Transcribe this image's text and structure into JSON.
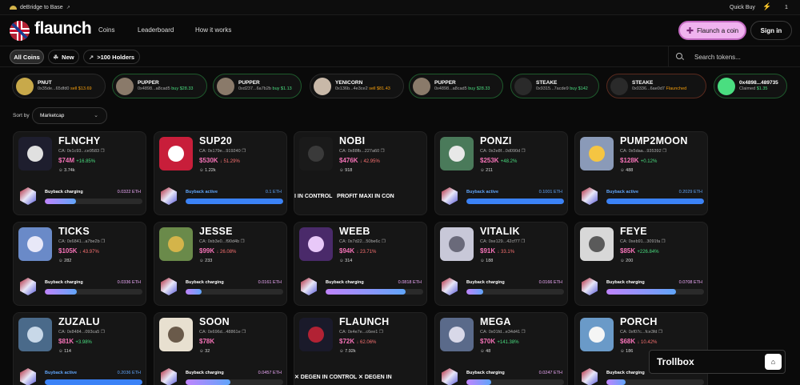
{
  "topbar": {
    "bridge_label": "deBridge to Base",
    "quick_buy": "Quick Buy",
    "quick_buy_count": "1"
  },
  "nav": {
    "brand": "flaunch",
    "links": [
      "Coins",
      "Leaderboard",
      "How it works"
    ],
    "flaunch_button": "Flaunch a coin",
    "signin_button": "Sign in"
  },
  "filters": {
    "all_coins": "All Coins",
    "new": "New",
    "holders": ">100 Holders",
    "search_placeholder": "Search tokens..."
  },
  "tickers": [
    {
      "symbol": "PNUT",
      "address": "0x35de...65dfd0",
      "action": "sell",
      "amount": "$13.69",
      "color": "#c8a94a"
    },
    {
      "symbol": "PUPPER",
      "address": "0x4898...a8cad5",
      "action": "buy",
      "amount": "$28.33",
      "color": "#8a7a6a"
    },
    {
      "symbol": "PUPPER",
      "address": "0xd237...6a7b2b",
      "action": "buy",
      "amount": "$1.13",
      "color": "#8a7a6a"
    },
    {
      "symbol": "YENICORN",
      "address": "0x136b...4e3ce2",
      "action": "sell",
      "amount": "$81.43",
      "color": "#c8b8a8"
    },
    {
      "symbol": "PUPPER",
      "address": "0x4898...a8cad5",
      "action": "buy",
      "amount": "$28.33",
      "color": "#8a7a6a"
    },
    {
      "symbol": "STEAKE",
      "address": "0x9315...7acde9",
      "action": "buy",
      "amount": "$142",
      "color": "#2a2a2a"
    },
    {
      "symbol": "STEAKE",
      "address": "0x0336...6ae0d7",
      "action": "Flaunched",
      "amount": "",
      "color": "#2a2a2a"
    },
    {
      "symbol": "0x4898...489735",
      "address": "Claimed",
      "action": "",
      "amount": "$1.35",
      "color": "#4ade80"
    }
  ],
  "sort": {
    "label": "Sort by",
    "value": "Marketcap"
  },
  "cards": [
    {
      "name": "FLNCHY",
      "ca": "CA: 0x1c93...ce9583",
      "mcap": "$74M",
      "change": "+16.85%",
      "dir": "up",
      "holders": "3.74k",
      "status": "Buyback charging",
      "eth": "0.0322 ETH",
      "progress": 0.32,
      "img": "#1e1e2e",
      "dot": "#e0e0e0"
    },
    {
      "name": "SUP20",
      "ca": "CA: 0x179e...919240",
      "mcap": "$530K",
      "change": "↓ 51.29%",
      "dir": "dn",
      "holders": "1.22k",
      "status": "Buyback active",
      "eth": "0.1 ETH",
      "progress": 1.0,
      "img": "#c81e3a",
      "dot": "#ffffff"
    },
    {
      "name": "NOBI",
      "ca": "CA: 0x88fb...227a60",
      "mcap": "$476K",
      "change": "↓ 42.95%",
      "dir": "dn",
      "holders": "918",
      "status": "",
      "eth": "",
      "progress": 0,
      "img": "#1a1a1a",
      "dot": "#3a3a3a",
      "marquee": "I IN CONTROL   PROFIT MAXI IN CON"
    },
    {
      "name": "PONZI",
      "ca": "CA: 0x2e8f...0d090d",
      "mcap": "$253K",
      "change": "+48.2%",
      "dir": "up",
      "holders": "211",
      "status": "Buyback active",
      "eth": "0.1001 ETH",
      "progress": 1.0,
      "img": "#4a7a5a",
      "dot": "#e8e8e8"
    },
    {
      "name": "PUMP2MOON",
      "ca": "CA: 0x5daa...935392",
      "mcap": "$128K",
      "change": "+0.12%",
      "dir": "up",
      "holders": "488",
      "status": "Buyback active",
      "eth": "0.2029 ETH",
      "progress": 1.0,
      "img": "#8a9ab8",
      "dot": "#f5c542"
    },
    {
      "name": "TICKS",
      "ca": "CA: 0x6841...a7be2b",
      "mcap": "$105K",
      "change": "↓ 43.97%",
      "dir": "dn",
      "holders": "282",
      "status": "Buyback charging",
      "eth": "0.0336 ETH",
      "progress": 0.33,
      "img": "#6a8ac8",
      "dot": "#e8e8f8"
    },
    {
      "name": "JESSE",
      "ca": "CA: 0xb3e0...f90d4b",
      "mcap": "$99K",
      "change": "↓ 26.08%",
      "dir": "dn",
      "holders": "233",
      "status": "Buyback charging",
      "eth": "0.0161 ETH",
      "progress": 0.16,
      "img": "#6a8a4a",
      "dot": "#d4b44a"
    },
    {
      "name": "WEEB",
      "ca": "CA: 0x7d22...50be6c",
      "mcap": "$94K",
      "change": "↓ 23.71%",
      "dir": "dn",
      "holders": "314",
      "status": "Buyback charging",
      "eth": "0.0818 ETH",
      "progress": 0.82,
      "img": "#4a2a6a",
      "dot": "#e8c8f8"
    },
    {
      "name": "VITALIK",
      "ca": "CA: 0xe129...42cf77",
      "mcap": "$91K",
      "change": "↓ 33.1%",
      "dir": "dn",
      "holders": "188",
      "status": "Buyback charging",
      "eth": "0.0166 ETH",
      "progress": 0.17,
      "img": "#c8c8d8",
      "dot": "#6a6a7a"
    },
    {
      "name": "FEYE",
      "ca": "CA: 0xeb91...3091fa",
      "mcap": "$85K",
      "change": "+226.84%",
      "dir": "up",
      "holders": "200",
      "status": "Buyback charging",
      "eth": "0.0708 ETH",
      "progress": 0.71,
      "img": "#d8d8d8",
      "dot": "#5a5a5a"
    },
    {
      "name": "ZUZALU",
      "ca": "CA: 0x8484...093ca5",
      "mcap": "$81K",
      "change": "+3.98%",
      "dir": "up",
      "holders": "114",
      "status": "Buyback active",
      "eth": "0.2036 ETH",
      "progress": 1.0,
      "img": "#4a6a8a",
      "dot": "#c8d8e8"
    },
    {
      "name": "SOON",
      "ca": "CA: 0x696d...48861e",
      "mcap": "$78K",
      "change": "",
      "dir": "up",
      "holders": "32",
      "status": "Buyback charging",
      "eth": "0.0457 ETH",
      "progress": 0.46,
      "img": "#e8e0d0",
      "dot": "#6a5a4a"
    },
    {
      "name": "FLAUNCH",
      "ca": "CA: 0x4e7e...c6ee1",
      "mcap": "$72K",
      "change": "↓ 62.06%",
      "dir": "dn",
      "holders": "7.92k",
      "status": "",
      "eth": "",
      "progress": 0,
      "img": "#1a1a2a",
      "dot": "#b22234",
      "marquee": "✕ DEGEN IN CONTROL ✕ DEGEN IN"
    },
    {
      "name": "MEGA",
      "ca": "CA: 0x01fd...e34d41",
      "mcap": "$70K",
      "change": "+141.38%",
      "dir": "up",
      "holders": "48",
      "status": "Buyback charging",
      "eth": "0.0247 ETH",
      "progress": 0.25,
      "img": "#5a6a8a",
      "dot": "#d8d8e8"
    },
    {
      "name": "PORCH",
      "ca": "CA: 0xf07c...fce3fd",
      "mcap": "$68K",
      "change": "↓ 10.42%",
      "dir": "dn",
      "holders": "186",
      "status": "Buyback charging",
      "eth": "",
      "progress": 0.2,
      "img": "#6a9ac8",
      "dot": "#f5f5f5"
    }
  ],
  "trollbox": {
    "title": "Trollbox"
  }
}
